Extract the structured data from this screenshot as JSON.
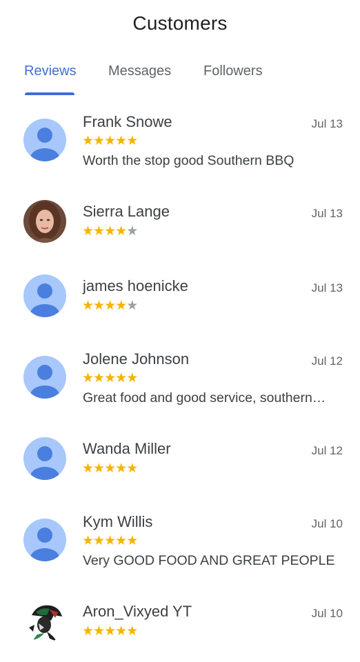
{
  "header": {
    "title": "Customers"
  },
  "tabs": [
    {
      "label": "Reviews",
      "active": true
    },
    {
      "label": "Messages",
      "active": false
    },
    {
      "label": "Followers",
      "active": false
    }
  ],
  "colors": {
    "accent": "#3d6fd6",
    "star": "#f4b400",
    "star_empty": "#9aa0a6",
    "avatar_placeholder_bg": "#a8c7fa",
    "avatar_placeholder_fg": "#4a7fdf"
  },
  "reviews": [
    {
      "name": "Frank Snowe",
      "date": "Jul 13",
      "rating": 5,
      "comment": "Worth the stop good Southern BBQ",
      "avatar": "person-placeholder-icon"
    },
    {
      "name": "Sierra Lange",
      "date": "Jul 13",
      "rating": 4,
      "comment": "",
      "avatar": "profile-photo"
    },
    {
      "name": "james hoenicke",
      "date": "Jul 13",
      "rating": 4,
      "comment": "",
      "avatar": "person-placeholder-icon"
    },
    {
      "name": "Jolene Johnson",
      "date": "Jul 12",
      "rating": 5,
      "comment": "Great food and good service, southern…",
      "avatar": "person-placeholder-icon"
    },
    {
      "name": "Wanda Miller",
      "date": "Jul 12",
      "rating": 5,
      "comment": "",
      "avatar": "person-placeholder-icon"
    },
    {
      "name": "Kym Willis",
      "date": "Jul 10",
      "rating": 5,
      "comment": "Very GOOD FOOD AND GREAT PEOPLE",
      "avatar": "person-placeholder-icon"
    },
    {
      "name": "Aron_Vixyed YT",
      "date": "Jul 10",
      "rating": 5,
      "comment": "",
      "avatar": "profile-photo"
    }
  ]
}
